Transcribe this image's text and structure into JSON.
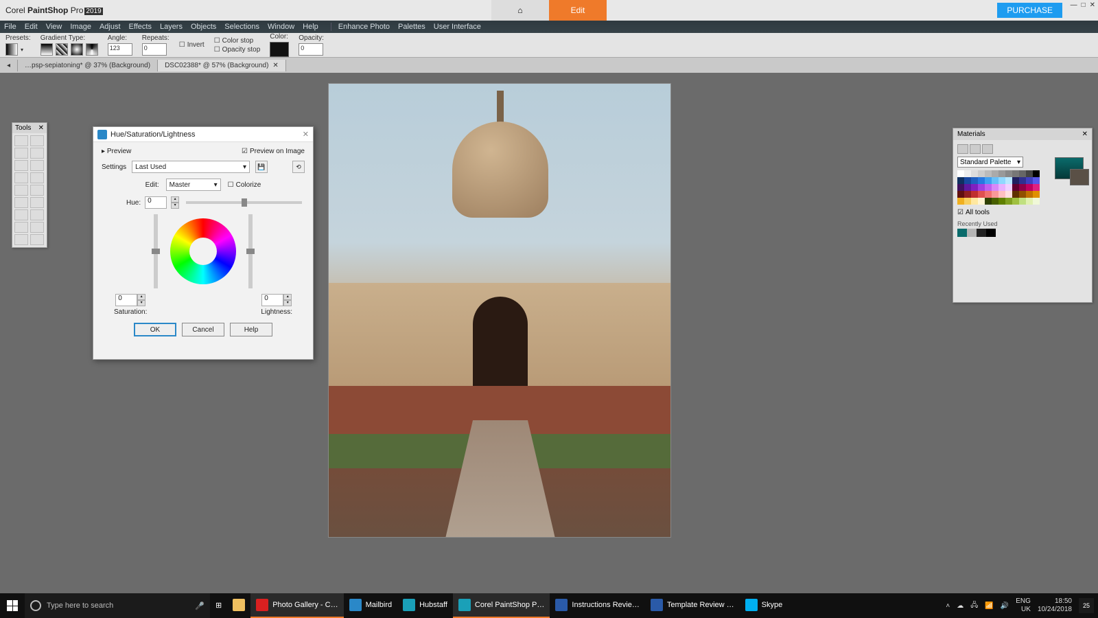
{
  "app": {
    "name_prefix": "Corel",
    "name_mid": "PaintShop",
    "name_suffix": "Pro",
    "year": "2019"
  },
  "modes": {
    "home": "⌂",
    "edit": "Edit"
  },
  "purchase": "PURCHASE",
  "menu": [
    "File",
    "Edit",
    "View",
    "Image",
    "Adjust",
    "Effects",
    "Layers",
    "Objects",
    "Selections",
    "Window",
    "Help",
    "Enhance Photo",
    "Palettes",
    "User Interface"
  ],
  "options": {
    "presets": "Presets:",
    "gradient_type": "Gradient Type:",
    "angle": "Angle:",
    "angle_val": "123",
    "repeats": "Repeats:",
    "repeats_val": "0",
    "invert": "Invert",
    "color_stop": "Color stop",
    "opacity_stop": "Opacity stop",
    "color": "Color:",
    "opacity": "Opacity:",
    "opacity_val": "0"
  },
  "tabs": [
    {
      "label": "…psp-sepiatoning* @ 37% (Background)",
      "active": false
    },
    {
      "label": "DSC02388* @ 57% (Background)",
      "active": true
    }
  ],
  "tools": {
    "title": "Tools"
  },
  "materials": {
    "title": "Materials",
    "palette": "Standard Palette",
    "all_tools": "All tools",
    "recent": "Recently Used",
    "fg": "#0a6b6b",
    "bg": "#5a5046",
    "palette_colors": [
      "#ffffff",
      "#eeeeee",
      "#dddddd",
      "#cccccc",
      "#bbbbbb",
      "#aaaaaa",
      "#999999",
      "#888888",
      "#777777",
      "#666666",
      "#444444",
      "#000000",
      "#103060",
      "#1848a0",
      "#2060c0",
      "#2878e0",
      "#40a0f0",
      "#68c0f8",
      "#90d8ff",
      "#b8e8ff",
      "#202060",
      "#303090",
      "#4040c0",
      "#5858e8",
      "#401060",
      "#6018a0",
      "#8020c0",
      "#a040e0",
      "#c060f0",
      "#d888f8",
      "#e8b0ff",
      "#f0d0ff",
      "#600030",
      "#900048",
      "#c00060",
      "#e02080",
      "#601010",
      "#902020",
      "#c03030",
      "#e05050",
      "#f07070",
      "#f89898",
      "#ffc0c0",
      "#ffe0e0",
      "#603000",
      "#905000",
      "#c07000",
      "#e09000",
      "#f0b020",
      "#f8d060",
      "#ffe8a0",
      "#fff4d0",
      "#304000",
      "#486000",
      "#608000",
      "#80a020",
      "#a0c040",
      "#c0e080",
      "#e0f0b0",
      "#f0f8d8"
    ],
    "recent_colors": [
      "#0a6b6b",
      "#b5b5b5",
      "#222222",
      "#000000"
    ]
  },
  "dialog": {
    "title": "Hue/Saturation/Lightness",
    "preview": "Preview",
    "preview_on_image": "Preview on Image",
    "settings": "Settings",
    "settings_val": "Last Used",
    "edit": "Edit:",
    "edit_val": "Master",
    "colorize": "Colorize",
    "hue": "Hue:",
    "hue_val": "0",
    "saturation": "Saturation:",
    "sat_val": "0",
    "lightness": "Lightness:",
    "light_val": "0",
    "ok": "OK",
    "cancel": "Cancel",
    "help": "Help"
  },
  "taskbar": {
    "search_placeholder": "Type here to search",
    "items": [
      {
        "label": "Photo Gallery - C…",
        "color": "#d92020",
        "active": true
      },
      {
        "label": "Mailbird",
        "color": "#2a88c8",
        "active": false
      },
      {
        "label": "Hubstaff",
        "color": "#1aa0b8",
        "active": false
      },
      {
        "label": "Corel PaintShop P…",
        "color": "#1aa0b8",
        "active": true
      },
      {
        "label": "Instructions Revie…",
        "color": "#2a5aa8",
        "active": false
      },
      {
        "label": "Template Review …",
        "color": "#2a5aa8",
        "active": false
      },
      {
        "label": "Skype",
        "color": "#00aff0",
        "active": false
      }
    ],
    "lang1": "ENG",
    "lang2": "UK",
    "time": "18:50",
    "date": "10/24/2018",
    "notif": "25"
  }
}
